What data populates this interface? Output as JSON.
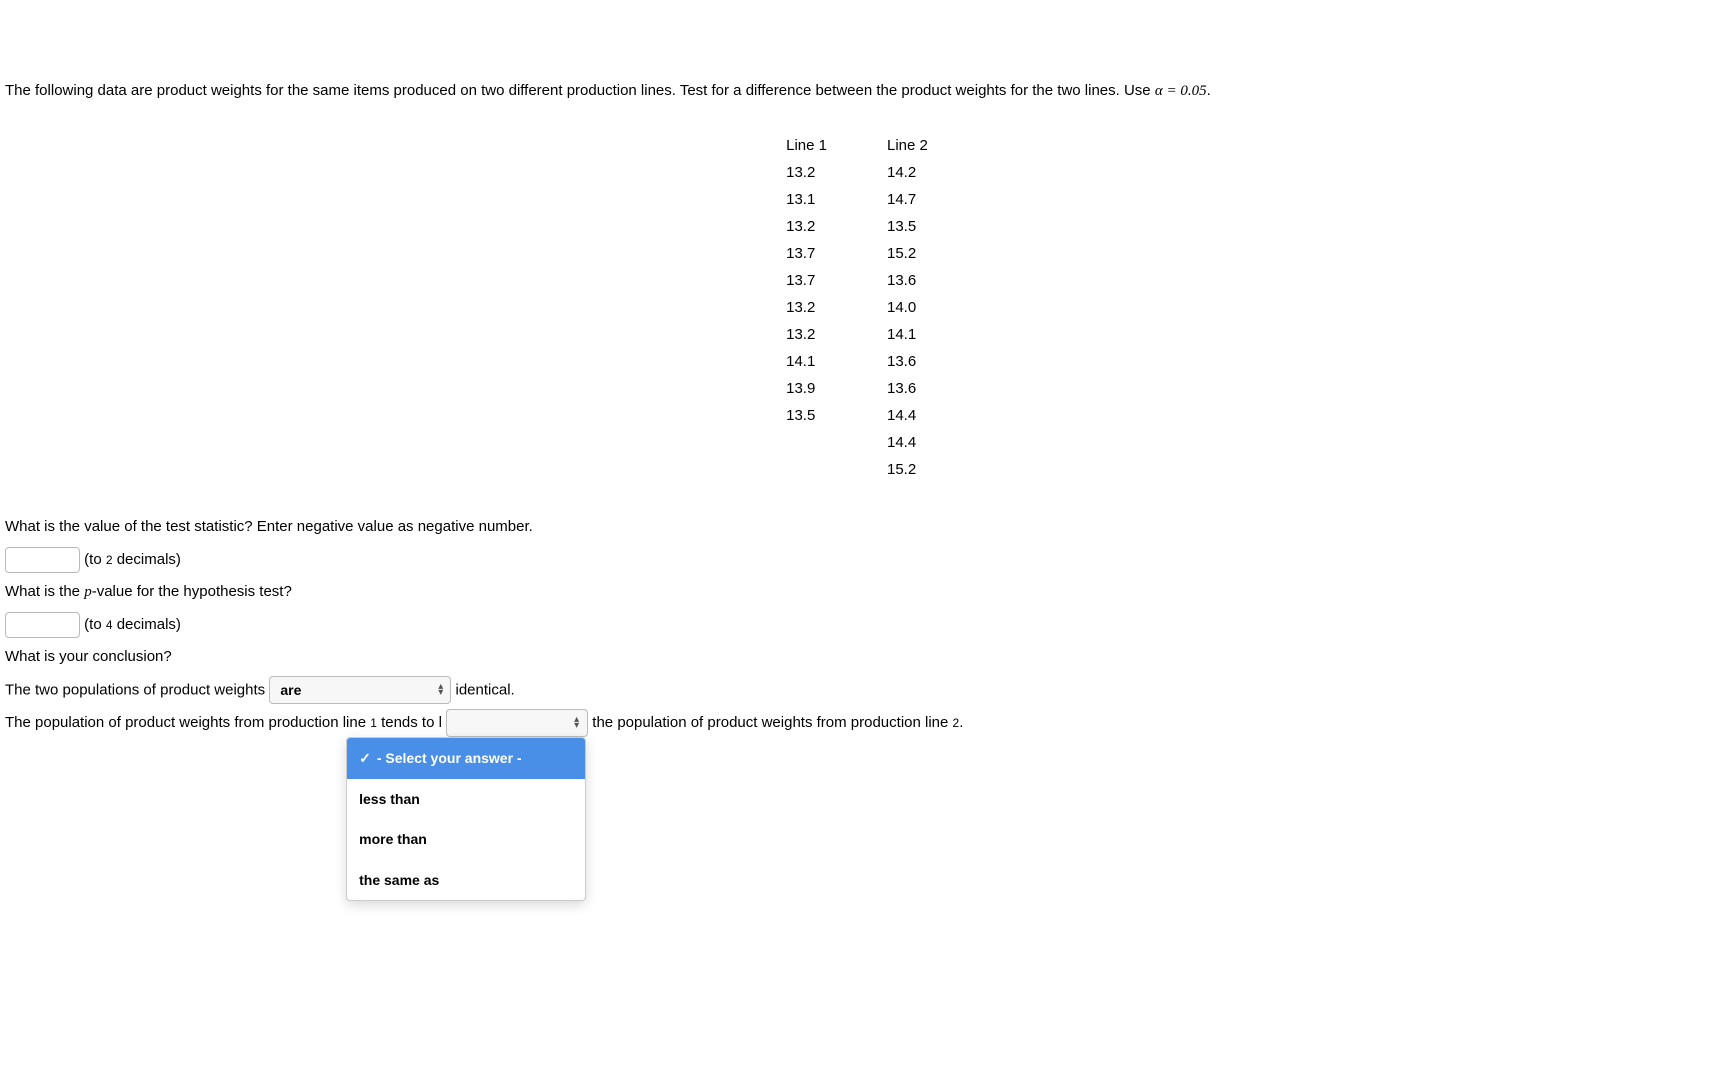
{
  "intro": {
    "text1": "The following data are product weights for the same items produced on two different production lines. Test for a difference between the product weights for the two lines. Use ",
    "alpha_expr": "α = 0.05",
    "period": "."
  },
  "table": {
    "headers": [
      "Line 1",
      "Line 2"
    ],
    "rows": [
      [
        "13.2",
        "14.2"
      ],
      [
        "13.1",
        "14.7"
      ],
      [
        "13.2",
        "13.5"
      ],
      [
        "13.7",
        "15.2"
      ],
      [
        "13.7",
        "13.6"
      ],
      [
        "13.2",
        "14.0"
      ],
      [
        "13.2",
        "14.1"
      ],
      [
        "14.1",
        "13.6"
      ],
      [
        "13.9",
        "13.6"
      ],
      [
        "13.5",
        "14.4"
      ],
      [
        "",
        "14.4"
      ],
      [
        "",
        "15.2"
      ]
    ]
  },
  "q1": {
    "prompt": "What is the value of the test statistic? Enter negative value as negative number.",
    "suffix1": " (to ",
    "decnum": "2",
    "suffix2": " decimals)"
  },
  "q2": {
    "prompt_prefix": "What is the ",
    "p": "p",
    "prompt_suffix": "-value for the hypothesis test?",
    "suffix1": " (to ",
    "decnum": "4",
    "suffix2": " decimals)"
  },
  "q3": {
    "prompt": "What is your conclusion?",
    "line1_prefix": "The two populations of product weights ",
    "select1_value": "are",
    "line1_suffix": " identical.",
    "line2_prefix": "The population of product weights from production line ",
    "one": "1",
    "line2_mid": " tends to l",
    "dropdown": {
      "placeholder": "- Select your answer -",
      "options": [
        "less than",
        "more than",
        "the same as"
      ]
    },
    "line2_suffix1": " the population of product weights from production line ",
    "two": "2",
    "line2_suffix2": "."
  }
}
